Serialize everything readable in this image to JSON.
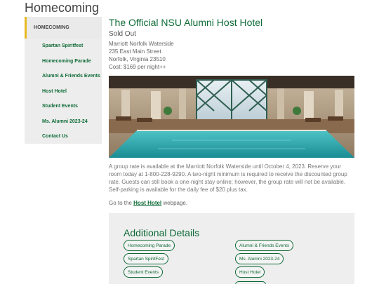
{
  "page": {
    "heading": "Homecoming"
  },
  "sidebar": {
    "header": "HOMECOMING",
    "items": [
      {
        "label": "Spartan Spiritfest"
      },
      {
        "label": "Homecoming Parade"
      },
      {
        "label": "Alumni & Friends Events"
      },
      {
        "label": "Host Hotel"
      },
      {
        "label": "Student Events"
      },
      {
        "label": "Ms. Alumni 2023-24"
      },
      {
        "label": "Contact Us"
      }
    ]
  },
  "hotel": {
    "title": "The Official NSU Alumni Host Hotel",
    "status": "Sold Out",
    "name": "Marriott Norfolk Waterside",
    "street": "235 East Main Street",
    "city": "Norfolk, Virginia 23510",
    "cost": "Cost: $169 per night++",
    "description": "A group rate is available at the Marriott Norfolk Waterside until October 4, 2023. Reserve your room today at 1-800-228-9290. A two-night minimum is required to receive the discounted group rate. Guests can still book a one-night stay online; however, the group rate will not be available. Self-parking is available for the daily fee of $20 plus tax.",
    "goto_prefix": "Go to the",
    "goto_link": "Host Hotel",
    "goto_suffix": "webpage."
  },
  "details": {
    "title": "Additional Details",
    "links": [
      {
        "label": "Homecoming Parade"
      },
      {
        "label": "Alumni & Friends Events"
      },
      {
        "label": "Spartan SpiritFest"
      },
      {
        "label": "Ms. Alumni 2023-24"
      },
      {
        "label": "Student Events"
      },
      {
        "label": "Host Hotel"
      }
    ]
  },
  "colors": {
    "brand_green": "#0e6b37",
    "accent_gold": "#e8b923",
    "panel_gray": "#eeeeee"
  }
}
